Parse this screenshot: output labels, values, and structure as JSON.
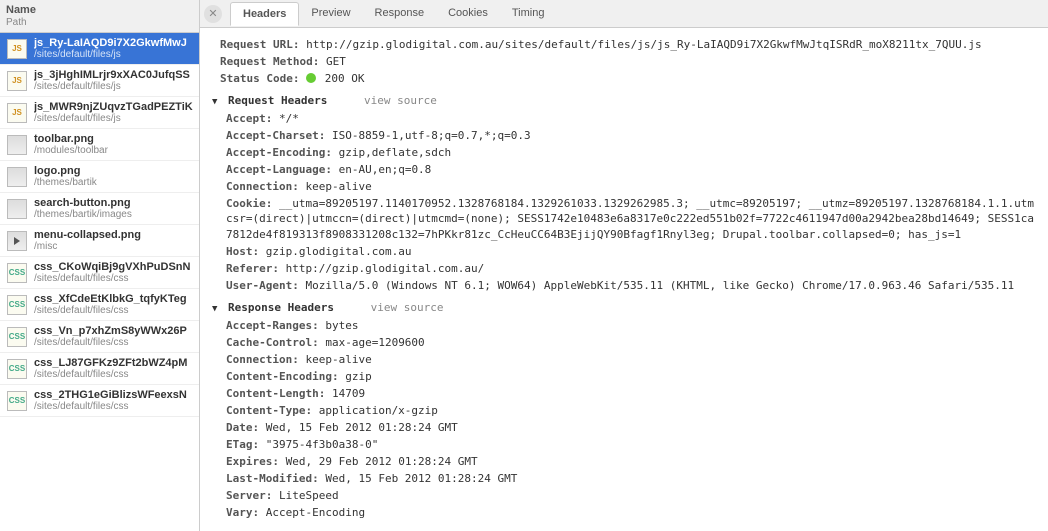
{
  "sidebar": {
    "header_name": "Name",
    "header_path": "Path",
    "items": [
      {
        "name": "js_Ry-LaIAQD9i7X2GkwfMwJ",
        "path": "/sites/default/files/js",
        "type": "js",
        "selected": true
      },
      {
        "name": "js_3jHghIMLrjr9xXAC0JufqSS",
        "path": "/sites/default/files/js",
        "type": "js"
      },
      {
        "name": "js_MWR9njZUqvzTGadPEZTiK",
        "path": "/sites/default/files/js",
        "type": "js"
      },
      {
        "name": "toolbar.png",
        "path": "/modules/toolbar",
        "type": "img"
      },
      {
        "name": "logo.png",
        "path": "/themes/bartik",
        "type": "img"
      },
      {
        "name": "search-button.png",
        "path": "/themes/bartik/images",
        "type": "img"
      },
      {
        "name": "menu-collapsed.png",
        "path": "/misc",
        "type": "play"
      },
      {
        "name": "css_CKoWqiBj9gVXhPuDSnN",
        "path": "/sites/default/files/css",
        "type": "css"
      },
      {
        "name": "css_XfCdeEtKlbkG_tqfyKTeg",
        "path": "/sites/default/files/css",
        "type": "css"
      },
      {
        "name": "css_Vn_p7xhZmS8yWWx26P",
        "path": "/sites/default/files/css",
        "type": "css"
      },
      {
        "name": "css_LJ87GFKz9ZFt2bWZ4pM",
        "path": "/sites/default/files/css",
        "type": "css"
      },
      {
        "name": "css_2THG1eGiBlizsWFeexsN",
        "path": "/sites/default/files/css",
        "type": "css"
      }
    ]
  },
  "tabs": {
    "items": [
      {
        "label": "Headers",
        "active": true
      },
      {
        "label": "Preview"
      },
      {
        "label": "Response"
      },
      {
        "label": "Cookies"
      },
      {
        "label": "Timing"
      }
    ]
  },
  "general": {
    "request_url_label": "Request URL:",
    "request_url": "http://gzip.glodigital.com.au/sites/default/files/js/js_Ry-LaIAQD9i7X2GkwfMwJtqISRdR_moX8211tx_7QUU.js",
    "request_method_label": "Request Method:",
    "request_method": "GET",
    "status_code_label": "Status Code:",
    "status_code": "200 OK"
  },
  "sections": {
    "request_title": "Request Headers",
    "response_title": "Response Headers",
    "view_source": "view source"
  },
  "request_headers": [
    {
      "k": "Accept:",
      "v": "*/*"
    },
    {
      "k": "Accept-Charset:",
      "v": "ISO-8859-1,utf-8;q=0.7,*;q=0.3"
    },
    {
      "k": "Accept-Encoding:",
      "v": "gzip,deflate,sdch"
    },
    {
      "k": "Accept-Language:",
      "v": "en-AU,en;q=0.8"
    },
    {
      "k": "Connection:",
      "v": "keep-alive"
    },
    {
      "k": "Cookie:",
      "v": "__utma=89205197.1140170952.1328768184.1329261033.1329262985.3; __utmc=89205197; __utmz=89205197.1328768184.1.1.utmcsr=(direct)|utmccn=(direct)|utmcmd=(none); SESS1742e10483e6a8317e0c222ed551b02f=7722c4611947d00a2942bea28bd14649; SESS1ca7812de4f819313f8908331208c132=7hPKkr81zc_CcHeuCC64B3EjijQY90Bfagf1Rnyl3eg; Drupal.toolbar.collapsed=0; has_js=1"
    },
    {
      "k": "Host:",
      "v": "gzip.glodigital.com.au"
    },
    {
      "k": "Referer:",
      "v": "http://gzip.glodigital.com.au/"
    },
    {
      "k": "User-Agent:",
      "v": "Mozilla/5.0 (Windows NT 6.1; WOW64) AppleWebKit/535.11 (KHTML, like Gecko) Chrome/17.0.963.46 Safari/535.11"
    }
  ],
  "response_headers": [
    {
      "k": "Accept-Ranges:",
      "v": "bytes"
    },
    {
      "k": "Cache-Control:",
      "v": "max-age=1209600"
    },
    {
      "k": "Connection:",
      "v": "keep-alive"
    },
    {
      "k": "Content-Encoding:",
      "v": "gzip"
    },
    {
      "k": "Content-Length:",
      "v": "14709"
    },
    {
      "k": "Content-Type:",
      "v": "application/x-gzip"
    },
    {
      "k": "Date:",
      "v": "Wed, 15 Feb 2012 01:28:24 GMT"
    },
    {
      "k": "ETag:",
      "v": "\"3975-4f3b0a38-0\""
    },
    {
      "k": "Expires:",
      "v": "Wed, 29 Feb 2012 01:28:24 GMT"
    },
    {
      "k": "Last-Modified:",
      "v": "Wed, 15 Feb 2012 01:28:24 GMT"
    },
    {
      "k": "Server:",
      "v": "LiteSpeed"
    },
    {
      "k": "Vary:",
      "v": "Accept-Encoding"
    }
  ]
}
